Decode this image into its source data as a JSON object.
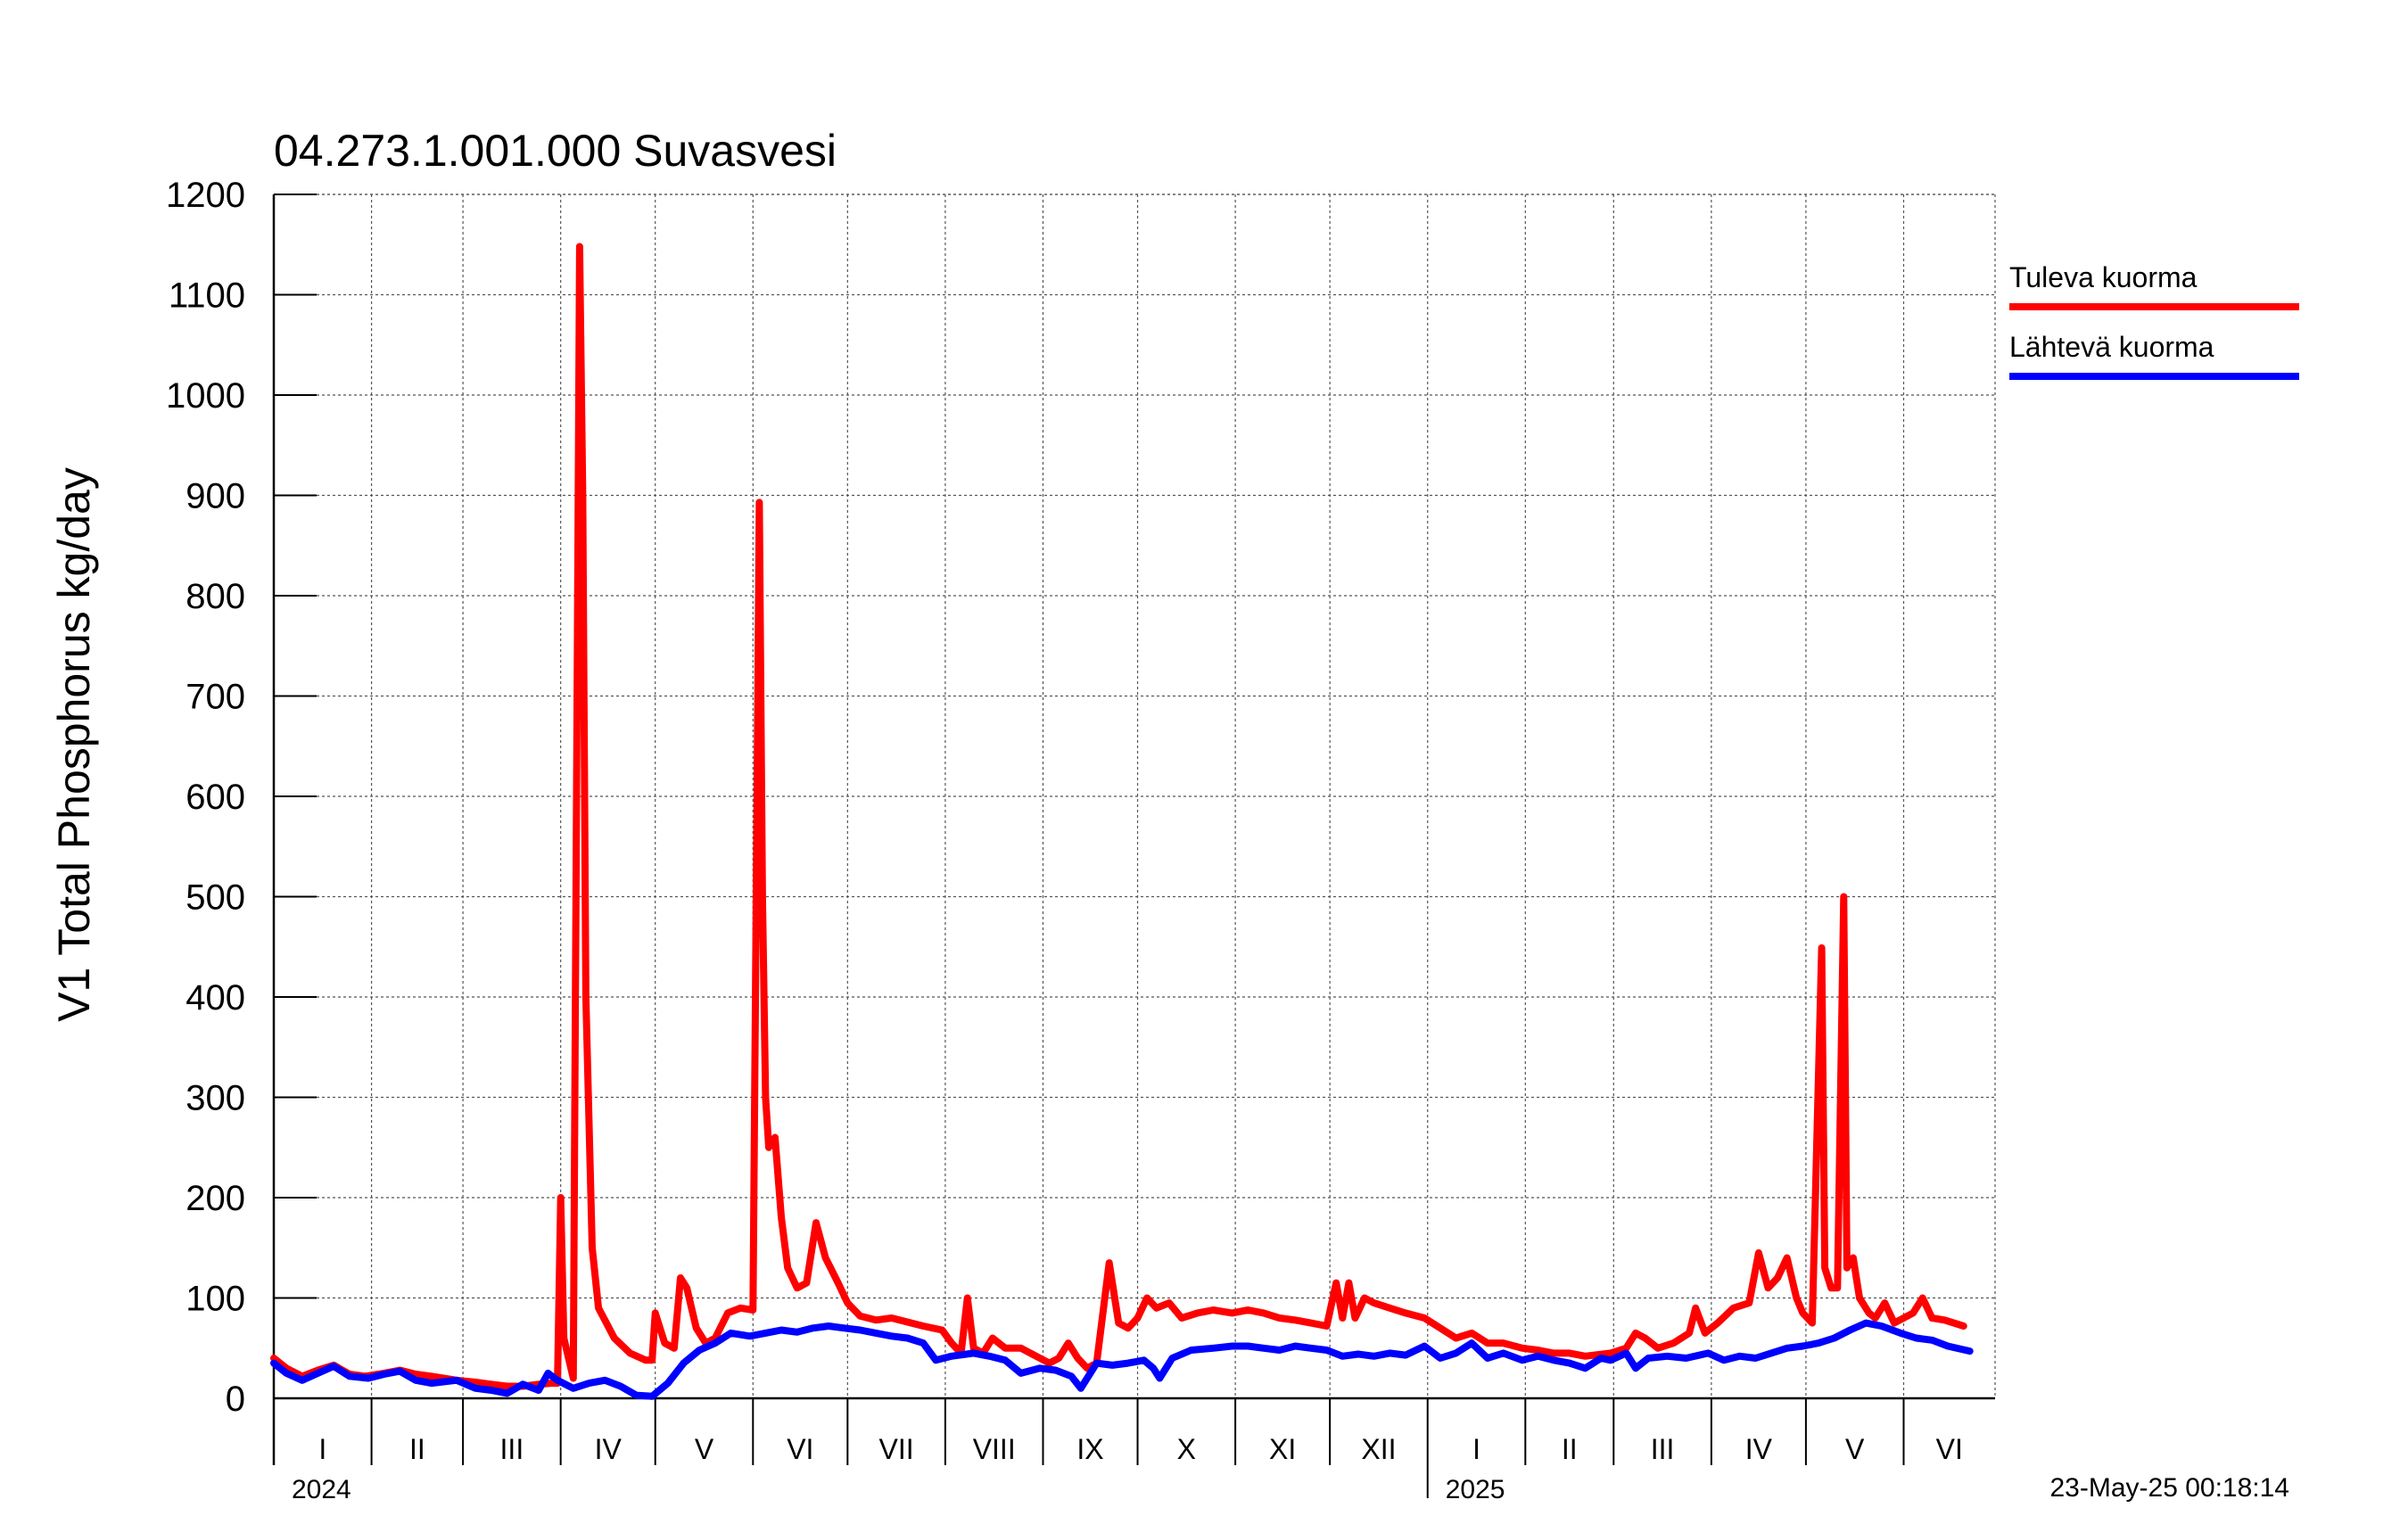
{
  "chart_data": {
    "type": "line",
    "title": "04.273.1.001.000 Suvasvesi",
    "ylabel": "V1 Total Phosphorus kg/day",
    "xlabel": "",
    "ylim": [
      0,
      1200
    ],
    "yticks": [
      0,
      100,
      200,
      300,
      400,
      500,
      600,
      700,
      800,
      900,
      1000,
      1100,
      1200
    ],
    "xlim": [
      "2024-01-01",
      "2025-06-30"
    ],
    "grid": true,
    "legend_position": "right",
    "timestamp": "23-May-25 00:18:14",
    "months": [
      {
        "label": "I",
        "start": "2024-01-01"
      },
      {
        "label": "II",
        "start": "2024-02-01"
      },
      {
        "label": "III",
        "start": "2024-03-01"
      },
      {
        "label": "IV",
        "start": "2024-04-01"
      },
      {
        "label": "V",
        "start": "2024-05-01"
      },
      {
        "label": "VI",
        "start": "2024-06-01"
      },
      {
        "label": "VII",
        "start": "2024-07-01"
      },
      {
        "label": "VIII",
        "start": "2024-08-01"
      },
      {
        "label": "IX",
        "start": "2024-09-01"
      },
      {
        "label": "X",
        "start": "2024-10-01"
      },
      {
        "label": "XI",
        "start": "2024-11-01"
      },
      {
        "label": "XII",
        "start": "2024-12-01"
      },
      {
        "label": "I",
        "start": "2025-01-01"
      },
      {
        "label": "II",
        "start": "2025-02-01"
      },
      {
        "label": "III",
        "start": "2025-03-01"
      },
      {
        "label": "IV",
        "start": "2025-04-01"
      },
      {
        "label": "V",
        "start": "2025-05-01"
      },
      {
        "label": "VI",
        "start": "2025-06-01"
      }
    ],
    "years": [
      {
        "label": "2024",
        "date": "2024-01-01"
      },
      {
        "label": "2025",
        "date": "2025-01-01"
      }
    ],
    "series": [
      {
        "name": "Tuleva kuorma",
        "color": "#ff0000",
        "points": [
          [
            "2024-01-01",
            40
          ],
          [
            "2024-01-05",
            30
          ],
          [
            "2024-01-10",
            22
          ],
          [
            "2024-01-15",
            28
          ],
          [
            "2024-01-20",
            33
          ],
          [
            "2024-01-25",
            24
          ],
          [
            "2024-01-30",
            22
          ],
          [
            "2024-02-05",
            25
          ],
          [
            "2024-02-10",
            28
          ],
          [
            "2024-02-15",
            24
          ],
          [
            "2024-02-20",
            22
          ],
          [
            "2024-02-28",
            18
          ],
          [
            "2024-03-05",
            16
          ],
          [
            "2024-03-10",
            14
          ],
          [
            "2024-03-15",
            12
          ],
          [
            "2024-03-20",
            12
          ],
          [
            "2024-03-25",
            14
          ],
          [
            "2024-03-29",
            15
          ],
          [
            "2024-03-31",
            15
          ],
          [
            "2024-04-01",
            200
          ],
          [
            "2024-04-02",
            60
          ],
          [
            "2024-04-05",
            20
          ],
          [
            "2024-04-07",
            1148
          ],
          [
            "2024-04-08",
            900
          ],
          [
            "2024-04-09",
            400
          ],
          [
            "2024-04-11",
            150
          ],
          [
            "2024-04-13",
            90
          ],
          [
            "2024-04-18",
            60
          ],
          [
            "2024-04-23",
            45
          ],
          [
            "2024-04-28",
            38
          ],
          [
            "2024-04-30",
            38
          ],
          [
            "2024-05-01",
            85
          ],
          [
            "2024-05-04",
            55
          ],
          [
            "2024-05-07",
            50
          ],
          [
            "2024-05-09",
            120
          ],
          [
            "2024-05-11",
            110
          ],
          [
            "2024-05-14",
            70
          ],
          [
            "2024-05-17",
            55
          ],
          [
            "2024-05-20",
            60
          ],
          [
            "2024-05-24",
            85
          ],
          [
            "2024-05-28",
            90
          ],
          [
            "2024-06-01",
            88
          ],
          [
            "2024-06-03",
            893
          ],
          [
            "2024-06-04",
            500
          ],
          [
            "2024-06-05",
            300
          ],
          [
            "2024-06-06",
            250
          ],
          [
            "2024-06-08",
            260
          ],
          [
            "2024-06-10",
            180
          ],
          [
            "2024-06-12",
            130
          ],
          [
            "2024-06-15",
            110
          ],
          [
            "2024-06-18",
            115
          ],
          [
            "2024-06-21",
            175
          ],
          [
            "2024-06-24",
            140
          ],
          [
            "2024-06-28",
            115
          ],
          [
            "2024-07-01",
            95
          ],
          [
            "2024-07-05",
            82
          ],
          [
            "2024-07-10",
            78
          ],
          [
            "2024-07-15",
            80
          ],
          [
            "2024-07-20",
            76
          ],
          [
            "2024-07-25",
            72
          ],
          [
            "2024-07-31",
            68
          ],
          [
            "2024-08-03",
            55
          ],
          [
            "2024-08-06",
            45
          ],
          [
            "2024-08-08",
            100
          ],
          [
            "2024-08-10",
            50
          ],
          [
            "2024-08-13",
            45
          ],
          [
            "2024-08-16",
            60
          ],
          [
            "2024-08-20",
            50
          ],
          [
            "2024-08-25",
            50
          ],
          [
            "2024-08-31",
            40
          ],
          [
            "2024-09-03",
            35
          ],
          [
            "2024-09-06",
            40
          ],
          [
            "2024-09-09",
            55
          ],
          [
            "2024-09-12",
            40
          ],
          [
            "2024-09-15",
            30
          ],
          [
            "2024-09-18",
            35
          ],
          [
            "2024-09-22",
            135
          ],
          [
            "2024-09-25",
            75
          ],
          [
            "2024-09-28",
            70
          ],
          [
            "2024-10-01",
            80
          ],
          [
            "2024-10-04",
            100
          ],
          [
            "2024-10-07",
            90
          ],
          [
            "2024-10-11",
            95
          ],
          [
            "2024-10-15",
            80
          ],
          [
            "2024-10-20",
            85
          ],
          [
            "2024-10-25",
            88
          ],
          [
            "2024-10-31",
            85
          ],
          [
            "2024-11-05",
            88
          ],
          [
            "2024-11-10",
            85
          ],
          [
            "2024-11-15",
            80
          ],
          [
            "2024-11-20",
            78
          ],
          [
            "2024-11-25",
            75
          ],
          [
            "2024-11-30",
            72
          ],
          [
            "2024-12-03",
            115
          ],
          [
            "2024-12-05",
            80
          ],
          [
            "2024-12-07",
            115
          ],
          [
            "2024-12-09",
            80
          ],
          [
            "2024-12-12",
            100
          ],
          [
            "2024-12-15",
            95
          ],
          [
            "2024-12-20",
            90
          ],
          [
            "2024-12-25",
            85
          ],
          [
            "2024-12-31",
            80
          ],
          [
            "2025-01-05",
            70
          ],
          [
            "2025-01-10",
            60
          ],
          [
            "2025-01-15",
            65
          ],
          [
            "2025-01-20",
            55
          ],
          [
            "2025-01-25",
            55
          ],
          [
            "2025-01-31",
            50
          ],
          [
            "2025-02-05",
            48
          ],
          [
            "2025-02-10",
            45
          ],
          [
            "2025-02-15",
            45
          ],
          [
            "2025-02-20",
            42
          ],
          [
            "2025-02-28",
            45
          ],
          [
            "2025-03-05",
            50
          ],
          [
            "2025-03-08",
            65
          ],
          [
            "2025-03-11",
            60
          ],
          [
            "2025-03-15",
            50
          ],
          [
            "2025-03-20",
            55
          ],
          [
            "2025-03-25",
            65
          ],
          [
            "2025-03-27",
            90
          ],
          [
            "2025-03-30",
            65
          ],
          [
            "2025-04-03",
            75
          ],
          [
            "2025-04-08",
            90
          ],
          [
            "2025-04-13",
            95
          ],
          [
            "2025-04-16",
            145
          ],
          [
            "2025-04-19",
            110
          ],
          [
            "2025-04-22",
            120
          ],
          [
            "2025-04-25",
            140
          ],
          [
            "2025-04-28",
            100
          ],
          [
            "2025-04-30",
            85
          ],
          [
            "2025-05-03",
            75
          ],
          [
            "2025-05-06",
            449
          ],
          [
            "2025-05-07",
            130
          ],
          [
            "2025-05-09",
            110
          ],
          [
            "2025-05-11",
            110
          ],
          [
            "2025-05-13",
            500
          ],
          [
            "2025-05-14",
            130
          ],
          [
            "2025-05-16",
            140
          ],
          [
            "2025-05-18",
            100
          ],
          [
            "2025-05-21",
            85
          ],
          [
            "2025-05-23",
            80
          ],
          [
            "2025-05-26",
            95
          ],
          [
            "2025-05-29",
            75
          ],
          [
            "2025-06-01",
            80
          ],
          [
            "2025-06-04",
            85
          ],
          [
            "2025-06-07",
            100
          ],
          [
            "2025-06-10",
            80
          ],
          [
            "2025-06-14",
            78
          ],
          [
            "2025-06-20",
            72
          ]
        ]
      },
      {
        "name": "Lähtevä kuorma",
        "color": "#0000ff",
        "points": [
          [
            "2024-01-01",
            35
          ],
          [
            "2024-01-05",
            25
          ],
          [
            "2024-01-10",
            18
          ],
          [
            "2024-01-15",
            25
          ],
          [
            "2024-01-20",
            32
          ],
          [
            "2024-01-25",
            22
          ],
          [
            "2024-01-31",
            20
          ],
          [
            "2024-02-05",
            24
          ],
          [
            "2024-02-10",
            27
          ],
          [
            "2024-02-15",
            18
          ],
          [
            "2024-02-20",
            15
          ],
          [
            "2024-02-28",
            18
          ],
          [
            "2024-03-05",
            10
          ],
          [
            "2024-03-10",
            8
          ],
          [
            "2024-03-15",
            5
          ],
          [
            "2024-03-20",
            14
          ],
          [
            "2024-03-25",
            8
          ],
          [
            "2024-03-28",
            25
          ],
          [
            "2024-03-31",
            18
          ],
          [
            "2024-04-05",
            10
          ],
          [
            "2024-04-10",
            15
          ],
          [
            "2024-04-15",
            18
          ],
          [
            "2024-04-20",
            12
          ],
          [
            "2024-04-25",
            3
          ],
          [
            "2024-04-30",
            2
          ],
          [
            "2024-05-05",
            15
          ],
          [
            "2024-05-10",
            35
          ],
          [
            "2024-05-15",
            48
          ],
          [
            "2024-05-20",
            55
          ],
          [
            "2024-05-25",
            65
          ],
          [
            "2024-05-31",
            62
          ],
          [
            "2024-06-05",
            65
          ],
          [
            "2024-06-10",
            68
          ],
          [
            "2024-06-15",
            66
          ],
          [
            "2024-06-20",
            70
          ],
          [
            "2024-06-25",
            72
          ],
          [
            "2024-06-30",
            70
          ],
          [
            "2024-07-05",
            68
          ],
          [
            "2024-07-10",
            65
          ],
          [
            "2024-07-15",
            62
          ],
          [
            "2024-07-20",
            60
          ],
          [
            "2024-07-25",
            55
          ],
          [
            "2024-07-29",
            38
          ],
          [
            "2024-08-03",
            42
          ],
          [
            "2024-08-10",
            45
          ],
          [
            "2024-08-15",
            42
          ],
          [
            "2024-08-20",
            38
          ],
          [
            "2024-08-25",
            25
          ],
          [
            "2024-08-31",
            30
          ],
          [
            "2024-09-05",
            28
          ],
          [
            "2024-09-10",
            22
          ],
          [
            "2024-09-13",
            10
          ],
          [
            "2024-09-18",
            35
          ],
          [
            "2024-09-23",
            33
          ],
          [
            "2024-09-28",
            35
          ],
          [
            "2024-10-03",
            38
          ],
          [
            "2024-10-06",
            30
          ],
          [
            "2024-10-08",
            20
          ],
          [
            "2024-10-12",
            40
          ],
          [
            "2024-10-18",
            48
          ],
          [
            "2024-10-25",
            50
          ],
          [
            "2024-10-31",
            52
          ],
          [
            "2024-11-05",
            52
          ],
          [
            "2024-11-10",
            50
          ],
          [
            "2024-11-15",
            48
          ],
          [
            "2024-11-20",
            52
          ],
          [
            "2024-11-25",
            50
          ],
          [
            "2024-11-30",
            48
          ],
          [
            "2024-12-05",
            42
          ],
          [
            "2024-12-10",
            44
          ],
          [
            "2024-12-15",
            42
          ],
          [
            "2024-12-20",
            45
          ],
          [
            "2024-12-25",
            43
          ],
          [
            "2024-12-31",
            52
          ],
          [
            "2025-01-05",
            40
          ],
          [
            "2025-01-10",
            45
          ],
          [
            "2025-01-15",
            55
          ],
          [
            "2025-01-20",
            40
          ],
          [
            "2025-01-25",
            45
          ],
          [
            "2025-01-31",
            38
          ],
          [
            "2025-02-05",
            42
          ],
          [
            "2025-02-10",
            38
          ],
          [
            "2025-02-15",
            35
          ],
          [
            "2025-02-20",
            30
          ],
          [
            "2025-02-25",
            40
          ],
          [
            "2025-02-28",
            38
          ],
          [
            "2025-03-05",
            45
          ],
          [
            "2025-03-08",
            30
          ],
          [
            "2025-03-12",
            40
          ],
          [
            "2025-03-18",
            42
          ],
          [
            "2025-03-24",
            40
          ],
          [
            "2025-03-31",
            45
          ],
          [
            "2025-04-05",
            38
          ],
          [
            "2025-04-10",
            42
          ],
          [
            "2025-04-15",
            40
          ],
          [
            "2025-04-20",
            45
          ],
          [
            "2025-04-25",
            50
          ],
          [
            "2025-04-30",
            52
          ],
          [
            "2025-05-05",
            55
          ],
          [
            "2025-05-10",
            60
          ],
          [
            "2025-05-15",
            68
          ],
          [
            "2025-05-20",
            75
          ],
          [
            "2025-05-25",
            72
          ],
          [
            "2025-05-31",
            65
          ],
          [
            "2025-06-05",
            60
          ],
          [
            "2025-06-10",
            58
          ],
          [
            "2025-06-15",
            52
          ],
          [
            "2025-06-22",
            47
          ]
        ]
      }
    ]
  }
}
